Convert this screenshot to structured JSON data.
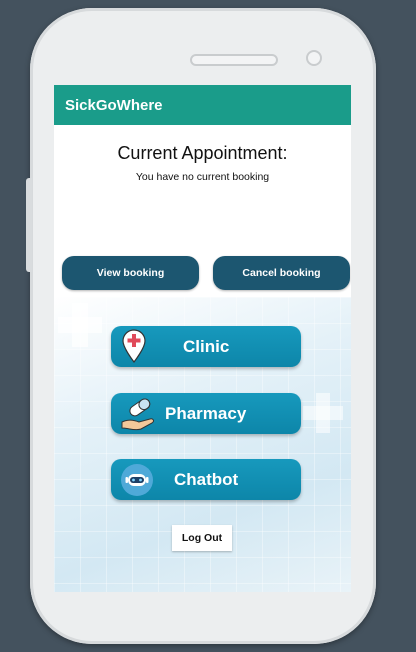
{
  "app": {
    "title": "SickGoWhere"
  },
  "appointment": {
    "heading": "Current Appointment:",
    "status": "You have no current booking"
  },
  "actions": {
    "view_booking": "View booking",
    "cancel_booking": "Cancel booking"
  },
  "menu": [
    {
      "label": "Clinic",
      "icon": "clinic-pin-icon"
    },
    {
      "label": "Pharmacy",
      "icon": "pill-hand-icon"
    },
    {
      "label": "Chatbot",
      "icon": "chatbot-icon"
    }
  ],
  "logout": {
    "label": "Log Out"
  },
  "colors": {
    "appbar": "#1a9c8a",
    "action_button": "#1c5670",
    "menu_button": "#1799bd",
    "frame_background": "#44525e"
  }
}
